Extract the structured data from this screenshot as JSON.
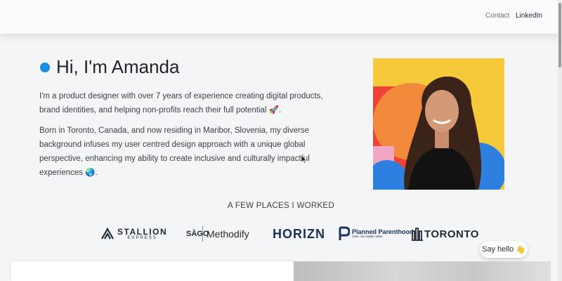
{
  "nav": {
    "contact_label": "Contact",
    "linkedin_label": "LinkedIn"
  },
  "hero": {
    "title": "Hi, I'm Amanda",
    "paragraph_1": "I'm a product designer with over 7 years of experience creating digital products, brand identities, and helping non-profits reach their full potential 🚀.",
    "paragraph_2": "Born in Toronto, Canada, and now residing in Maribor, Slovenia, my diverse background infuses my user centred design approach with a unique global perspective, enhancing my ability to create inclusive and culturally impactful experiences 🌏."
  },
  "places": {
    "heading": "A FEW PLACES I WORKED",
    "logos": [
      {
        "name": "STALLION",
        "sub": "EXPRESS"
      },
      {
        "name": "SĀGO",
        "sub": "Methodify"
      },
      {
        "name": "HORIZN"
      },
      {
        "name": "Planned Parenthood",
        "sub": "Care. No matter what."
      },
      {
        "name": "TORONTO"
      }
    ]
  },
  "say_hello": {
    "label": "Say hello",
    "emoji": "👋"
  },
  "colors": {
    "accent": "#1e88e5",
    "portrait_bg": "#f6c93a",
    "portrait_orange": "#f28a3c",
    "portrait_red": "#ef4136",
    "portrait_blue": "#2d7fe0"
  }
}
